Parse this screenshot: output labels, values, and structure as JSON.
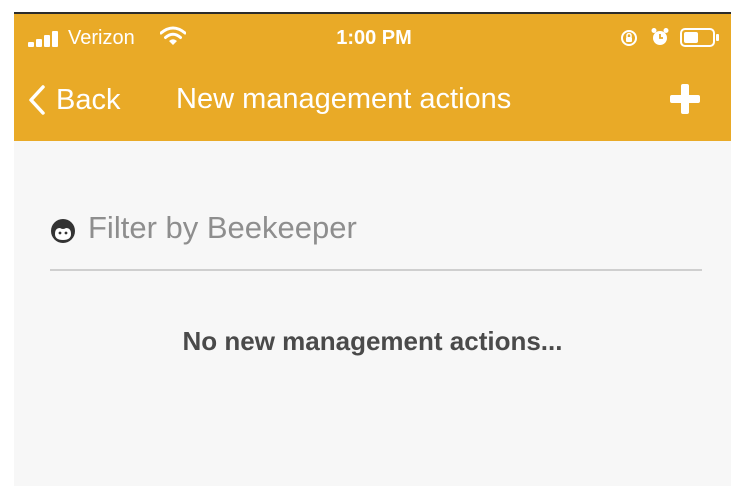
{
  "status_bar": {
    "carrier": "Verizon",
    "time": "1:00 PM",
    "icons": [
      "signal-icon",
      "wifi-icon",
      "rotation-lock-icon",
      "alarm-icon",
      "battery-icon"
    ]
  },
  "nav": {
    "back_label": "Back",
    "title": "New management actions",
    "add_icon": "plus-icon"
  },
  "filter": {
    "placeholder": "Filter by Beekeeper",
    "icon": "beekeeper-face-icon"
  },
  "empty_state": {
    "message": "No new management actions..."
  },
  "colors": {
    "header": "#e9aa27",
    "header_text": "#ffffff",
    "content_bg": "#f7f7f7",
    "placeholder": "#8e8e8e",
    "message": "#4a4a4a",
    "divider": "#cfcfcf"
  }
}
